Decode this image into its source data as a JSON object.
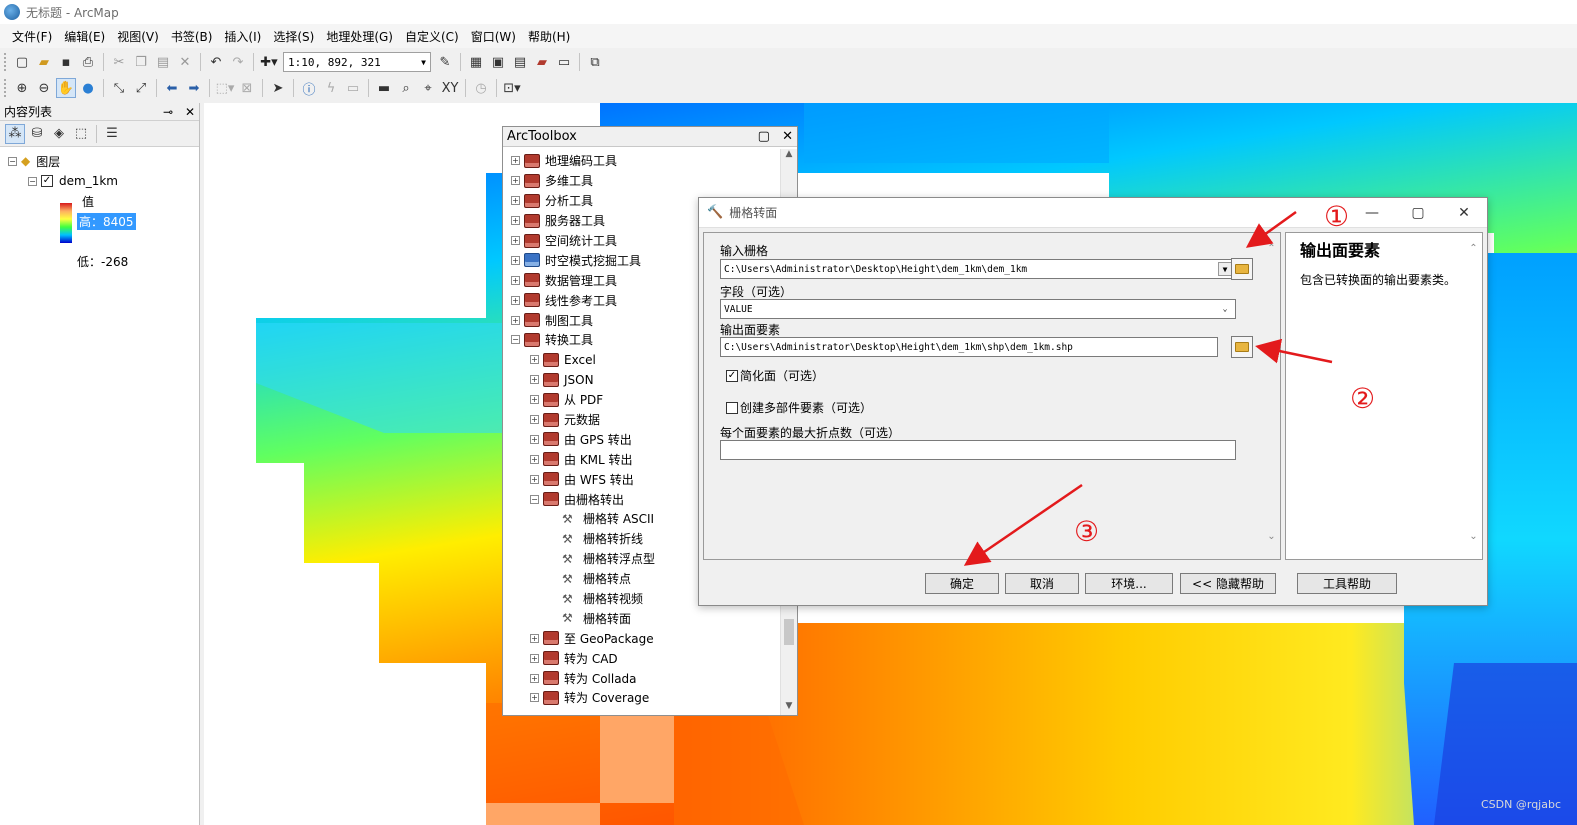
{
  "window": {
    "title": "无标题 - ArcMap"
  },
  "menu": [
    "文件(F)",
    "编辑(E)",
    "视图(V)",
    "书签(B)",
    "插入(I)",
    "选择(S)",
    "地理处理(G)",
    "自定义(C)",
    "窗口(W)",
    "帮助(H)"
  ],
  "toolbar": {
    "scale": "1:10, 892, 321"
  },
  "toc": {
    "title": "内容列表",
    "root_label": "图层",
    "layer_name": "dem_1km",
    "value_label": "值",
    "high_label": "高：8405",
    "low_label": "低：-268"
  },
  "toolbox": {
    "title": "ArcToolbox",
    "items": [
      {
        "label": "地理编码工具",
        "level": 0,
        "pm": "+",
        "icon": "toolbox"
      },
      {
        "label": "多维工具",
        "level": 0,
        "pm": "+",
        "icon": "toolbox"
      },
      {
        "label": "分析工具",
        "level": 0,
        "pm": "+",
        "icon": "toolbox"
      },
      {
        "label": "服务器工具",
        "level": 0,
        "pm": "+",
        "icon": "toolbox"
      },
      {
        "label": "空间统计工具",
        "level": 0,
        "pm": "+",
        "icon": "toolbox"
      },
      {
        "label": "时空模式挖掘工具",
        "level": 0,
        "pm": "+",
        "icon": "toolbox-blue"
      },
      {
        "label": "数据管理工具",
        "level": 0,
        "pm": "+",
        "icon": "toolbox"
      },
      {
        "label": "线性参考工具",
        "level": 0,
        "pm": "+",
        "icon": "toolbox"
      },
      {
        "label": "制图工具",
        "level": 0,
        "pm": "+",
        "icon": "toolbox"
      },
      {
        "label": "转换工具",
        "level": 0,
        "pm": "−",
        "icon": "toolbox"
      },
      {
        "label": "Excel",
        "level": 1,
        "pm": "+",
        "icon": "toolset"
      },
      {
        "label": "JSON",
        "level": 1,
        "pm": "+",
        "icon": "toolset"
      },
      {
        "label": "从 PDF",
        "level": 1,
        "pm": "+",
        "icon": "toolset"
      },
      {
        "label": "元数据",
        "level": 1,
        "pm": "+",
        "icon": "toolset"
      },
      {
        "label": "由 GPS 转出",
        "level": 1,
        "pm": "+",
        "icon": "toolset"
      },
      {
        "label": "由 KML 转出",
        "level": 1,
        "pm": "+",
        "icon": "toolset"
      },
      {
        "label": "由 WFS 转出",
        "level": 1,
        "pm": "+",
        "icon": "toolset"
      },
      {
        "label": "由栅格转出",
        "level": 1,
        "pm": "−",
        "icon": "toolset"
      },
      {
        "label": "栅格转 ASCII",
        "level": 2,
        "pm": "",
        "icon": "tool"
      },
      {
        "label": "栅格转折线",
        "level": 2,
        "pm": "",
        "icon": "tool"
      },
      {
        "label": "栅格转浮点型",
        "level": 2,
        "pm": "",
        "icon": "tool"
      },
      {
        "label": "栅格转点",
        "level": 2,
        "pm": "",
        "icon": "tool"
      },
      {
        "label": "栅格转视频",
        "level": 2,
        "pm": "",
        "icon": "tool"
      },
      {
        "label": "栅格转面",
        "level": 2,
        "pm": "",
        "icon": "tool"
      },
      {
        "label": "至 GeoPackage",
        "level": 1,
        "pm": "+",
        "icon": "toolset"
      },
      {
        "label": "转为 CAD",
        "level": 1,
        "pm": "+",
        "icon": "toolset"
      },
      {
        "label": "转为 Collada",
        "level": 1,
        "pm": "+",
        "icon": "toolset"
      },
      {
        "label": "转为 Coverage",
        "level": 1,
        "pm": "+",
        "icon": "toolset"
      }
    ]
  },
  "dialog": {
    "title": "栅格转面",
    "input_raster_label": "输入栅格",
    "input_raster_value": "C:\\Users\\Administrator\\Desktop\\Height\\dem_1km\\dem_1km",
    "field_label": "字段（可选）",
    "field_value": "VALUE",
    "output_label": "输出面要素",
    "output_value": "C:\\Users\\Administrator\\Desktop\\Height\\dem_1km\\shp\\dem_1km.shp",
    "simplify_label": "简化面（可选）",
    "simplify_checked": true,
    "multipart_label": "创建多部件要素（可选）",
    "multipart_checked": false,
    "maxverts_label": "每个面要素的最大折点数（可选）",
    "maxverts_value": "",
    "help_title": "输出面要素",
    "help_text": "包含已转换面的输出要素类。",
    "buttons": {
      "ok": "确定",
      "cancel": "取消",
      "env": "环境...",
      "hide_help": "<< 隐藏帮助",
      "tool_help": "工具帮助"
    }
  },
  "annotations": {
    "one": "①",
    "two": "②",
    "three": "③"
  },
  "watermark": "CSDN @rqjabc",
  "colors": {
    "arrow": "#e31a1c",
    "selection": "#3399ff"
  }
}
